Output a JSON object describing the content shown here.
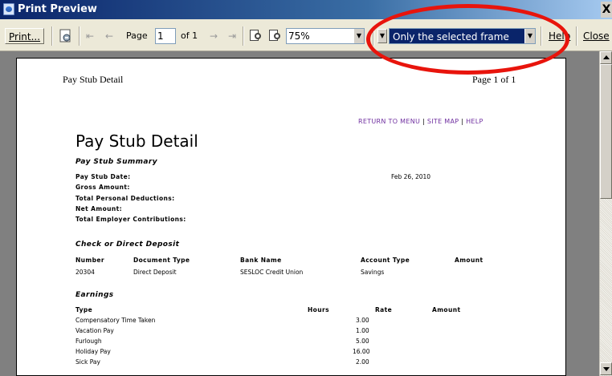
{
  "window": {
    "title": "Print Preview",
    "close_glyph": "X"
  },
  "toolbar": {
    "print_label": "Print...",
    "page_label": "Page",
    "page_value": "1",
    "of_label": "of 1",
    "zoom_value": "75%",
    "frame_option": "Only the selected frame",
    "help_label": "Help",
    "close_label": "Close",
    "nav_first": "⇤",
    "nav_prev": "←",
    "nav_next": "→",
    "nav_last": "⇥"
  },
  "page": {
    "header_left": "Pay Stub Detail",
    "header_right": "Page 1 of 1",
    "links": {
      "return": "RETURN TO MENU",
      "sitemap": "SITE MAP",
      "help": "HELP",
      "separator": "|"
    },
    "title": "Pay Stub Detail",
    "summary": {
      "heading": "Pay Stub Summary",
      "date_label": "Pay Stub Date:",
      "date_value": "Feb 26, 2010",
      "gross_label": "Gross Amount:",
      "deductions_label": "Total Personal Deductions:",
      "net_label": "Net Amount:",
      "employer_label": "Total Employer Contributions:"
    },
    "deposit": {
      "heading": "Check or Direct Deposit",
      "columns": [
        "Number",
        "Document Type",
        "Bank Name",
        "Account Type",
        "Amount"
      ],
      "row": [
        "20304",
        "Direct Deposit",
        "SESLOC Credit Union",
        "Savings",
        ""
      ]
    },
    "earnings": {
      "heading": "Earnings",
      "columns": [
        "Type",
        "Hours",
        "Rate",
        "Amount"
      ],
      "rows": [
        [
          "Compensatory Time Taken",
          "",
          "3.00",
          ""
        ],
        [
          "Vacation Pay",
          "",
          "1.00",
          ""
        ],
        [
          "Furlough",
          "",
          "5.00",
          ""
        ],
        [
          "Holiday Pay",
          "",
          "16.00",
          ""
        ],
        [
          "Sick Pay",
          "",
          "2.00",
          ""
        ]
      ]
    }
  },
  "colors": {
    "annotation": "#e8140c",
    "link": "#7030a0",
    "titlebar": "#0a246a"
  }
}
